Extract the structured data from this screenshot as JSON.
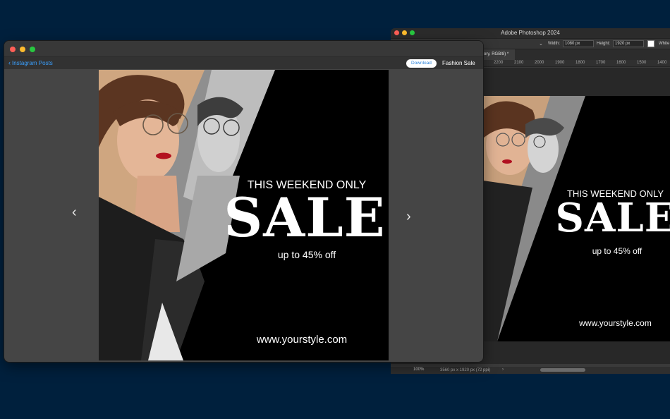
{
  "colors": {
    "desktop": "#00203d",
    "accent": "#3aa0ff",
    "close": "#ff5f57",
    "minimize": "#febc2e",
    "zoom": "#28c840"
  },
  "main_window": {
    "back_label": "Instagram Posts",
    "download_label": "Download",
    "title": "Fashion Sale",
    "prev_icon": "chevron-left-icon",
    "next_icon": "chevron-right-icon"
  },
  "poster": {
    "headline": "THIS WEEKEND ONLY",
    "sale": "SALE",
    "discount": "up to 45% off",
    "url": "www.yourstyle.com"
  },
  "photoshop": {
    "title": "Adobe Photoshop 2024",
    "width_label": "Width:",
    "width_value": "1080 px",
    "height_label": "Height:",
    "height_value": "1920 px",
    "swatch_label": "White",
    "doc_tab": "ory, RGB/8) *",
    "ruler": [
      "2200",
      "2100",
      "2000",
      "1900",
      "1800",
      "1700",
      "1600",
      "1500",
      "1400"
    ],
    "zoom": "100%",
    "doc_size": "3560 px x 1920 px (72 ppi)"
  }
}
